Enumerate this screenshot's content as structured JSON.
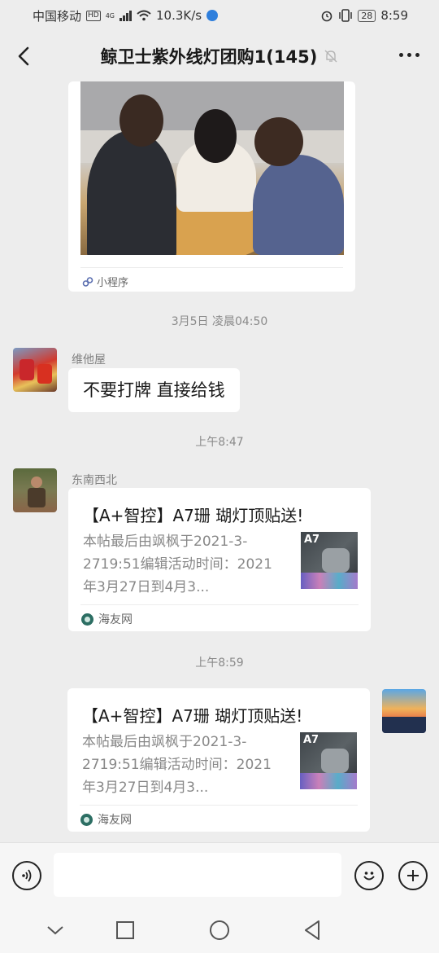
{
  "status_bar": {
    "carrier": "中国移动",
    "hd_badge": "HD",
    "network_type": "4G",
    "speed": "10.3K/s",
    "battery": "28",
    "time": "8:59"
  },
  "nav": {
    "title": "鲸卫士紫外线灯团购1(145)"
  },
  "messages": {
    "photo_card": {
      "source_label": "小程序"
    },
    "timestamp_1": "3月5日 凌晨04:50",
    "msg_1": {
      "sender": "维他屋",
      "text": "不要打牌 直接给钱"
    },
    "timestamp_2": "上午8:47",
    "msg_2": {
      "sender": "东南西北",
      "title": "【A+智控】A7珊 瑚灯顶贴送!",
      "desc": "本帖最后由飒枫于2021-3-2719:51编辑活动时间：2021年3月27日到4月3...",
      "thumb_label": "A7",
      "source": "海友网"
    },
    "timestamp_3": "上午8:59",
    "msg_3": {
      "title": "【A+智控】A7珊 瑚灯顶贴送!",
      "desc": "本帖最后由飒枫于2021-3-2719:51编辑活动时间：2021年3月27日到4月3...",
      "thumb_label": "A7",
      "source": "海友网"
    }
  },
  "input_bar": {
    "placeholder": ""
  },
  "icons": {
    "voice": "voice-icon",
    "emoji": "emoji-icon",
    "plus": "plus-icon",
    "back": "back-icon",
    "more": "more-icon",
    "mute": "mute-icon"
  }
}
